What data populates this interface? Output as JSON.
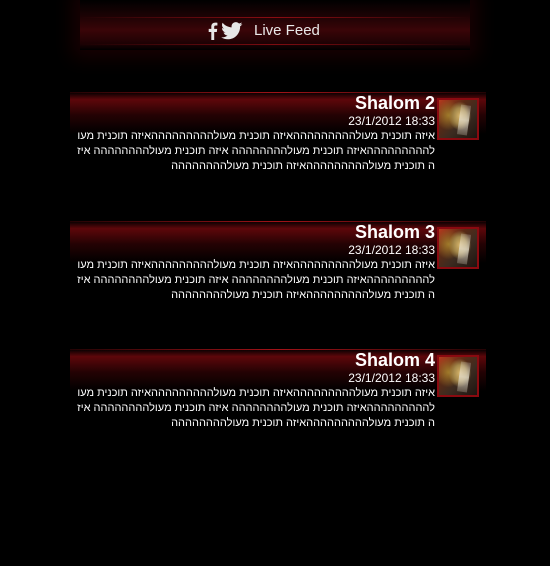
{
  "header": {
    "title": "Live Feed",
    "icons": [
      "facebook-icon",
      "twitter-icon"
    ]
  },
  "posts": [
    {
      "title": "Shalom 2",
      "time": "23/1/2012 18:33",
      "body": "איזה תוכנית מעולהההההההההאיזה תוכנית מעולהההההההההאיזה תוכנית מעולהההההההההאיזה תוכנית מעולהההההההה איזה תוכנית מעולהההההההה איזה תוכנית מעולהההההההההאיזה תוכנית מעולהההההההה"
    },
    {
      "title": "Shalom 3",
      "time": "23/1/2012 18:33",
      "body": "איזה תוכנית מעולהההההההההאיזה תוכנית מעולהההההההההאיזה תוכנית מעולהההההההההאיזה תוכנית מעולהההההההה איזה תוכנית מעולהההההההה איזה תוכנית מעולהההההההההאיזה תוכנית מעולהההההההה"
    },
    {
      "title": "Shalom 4",
      "time": "23/1/2012 18:33",
      "body": "איזה תוכנית מעולהההההההההאיזה תוכנית מעולהההההההההאיזה תוכנית מעולהההההההההאיזה תוכנית מעולהההההההה איזה תוכנית מעולהההההההה איזה תוכנית מעולהההההההההאיזה תוכנית מעולהההההההה"
    }
  ],
  "colors": {
    "background": "#000000",
    "accent": "#8a0a10",
    "text": "#ffffff"
  }
}
